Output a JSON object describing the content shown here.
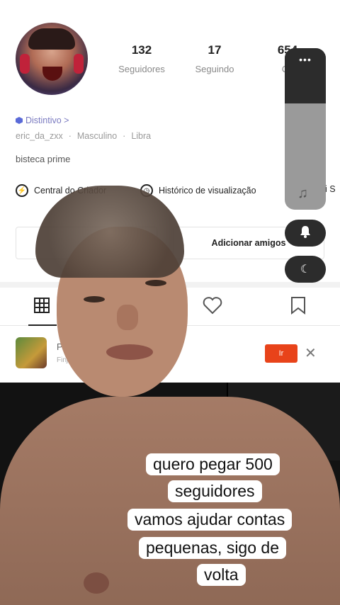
{
  "profile": {
    "followers_count": "132",
    "followers_label": "Seguidores",
    "following_count": "17",
    "following_label": "Seguindo",
    "likes_count": "654",
    "likes_label": "Cu",
    "badge_label": "Distintivo >",
    "username": "eric_da_zxx",
    "gender": "Masculino",
    "sign": "Libra",
    "bio": "bisteca prime"
  },
  "quick_links": {
    "creator_center": "Central do Criador",
    "history": "Histórico de visualização",
    "more": "ai S"
  },
  "buttons": {
    "add_friends": "Adicionar amigos"
  },
  "promo": {
    "title": "Par",
    "subtitle": "Finje d",
    "button_label": "Ir",
    "close_glyph": "✕"
  },
  "overlay_panel": {
    "dots": "•••",
    "note_icon": "♫",
    "bell_icon": "🔔",
    "moon_icon": "☾"
  },
  "caption": {
    "lines": [
      "quero pegar 500",
      "seguidores",
      "vamos ajudar contas",
      "pequenas, sigo de",
      "volta"
    ]
  },
  "colors": {
    "promo_button": "#e8431a",
    "badge": "#5a6ad8",
    "overlay_dark": "#2c2c2c"
  }
}
